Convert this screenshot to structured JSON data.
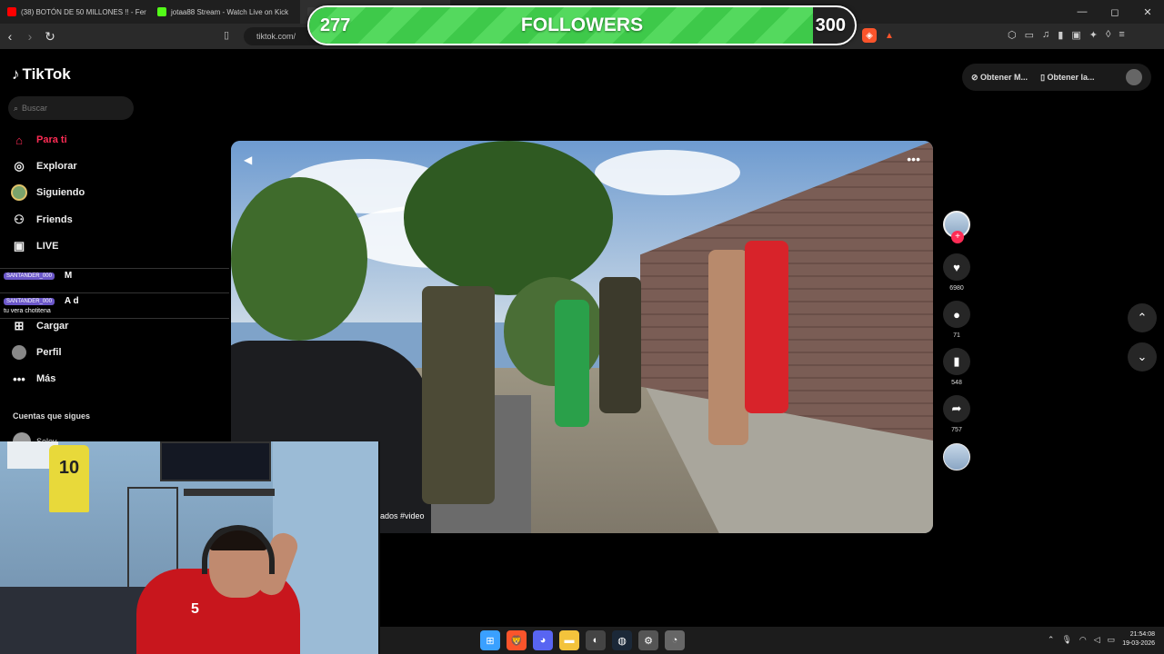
{
  "browser": {
    "tabs": [
      {
        "title": "(38) BOTÓN DE 50 MILLONES !! - Fer",
        "color": "#ff0000"
      },
      {
        "title": "jotaa88 Stream - Watch Live on Kick",
        "color": "#53fc18"
      },
      {
        "title": "",
        "color": "#3a3a3a"
      }
    ],
    "url": "tiktok.com/",
    "window_controls": {
      "minimize": "—",
      "maximize": "◻",
      "close": "✕"
    }
  },
  "overlay": {
    "goal_current": "277",
    "goal_title": "FOLLOWERS",
    "goal_max": "300",
    "progress_fraction": 0.923
  },
  "tiktok": {
    "logo": "TikTok",
    "search_placeholder": "Buscar",
    "sidebar": [
      {
        "label": "Para ti",
        "icon": "home-icon",
        "glyph": "⌂",
        "active": true
      },
      {
        "label": "Explorar",
        "icon": "compass-icon",
        "glyph": "◎",
        "active": false
      },
      {
        "label": "Siguiendo",
        "icon": "following-avatar-icon",
        "glyph": "●",
        "active": false
      },
      {
        "label": "Friends",
        "icon": "friends-icon",
        "glyph": "👥",
        "active": false
      },
      {
        "label": "LIVE",
        "icon": "live-icon",
        "glyph": "▣",
        "active": false
      },
      {
        "label": "Cargar",
        "icon": "upload-icon",
        "glyph": "⊞",
        "active": false
      },
      {
        "label": "Perfil",
        "icon": "profile-icon",
        "glyph": "◉",
        "active": false
      },
      {
        "label": "Más",
        "icon": "more-icon",
        "glyph": "•••",
        "active": false
      }
    ],
    "hidden_items": [
      "M",
      "A  d"
    ],
    "section_title": "Cuentas que sigues",
    "followed_account": "Selev",
    "chat": [
      {
        "badge": "SANTANDER_000",
        "text": ""
      },
      {
        "badge": "SANTANDER_000",
        "text": ""
      },
      {
        "badge": "",
        "text": "tu vera chotitena"
      }
    ],
    "top_actions": [
      "Obtener M...",
      "Obtener la..."
    ],
    "video_caption": "ados #video",
    "counts": {
      "likes": "6980",
      "comments": "71",
      "saves": "548",
      "shares": "757"
    }
  },
  "webcam": {
    "jersey_number": "10",
    "shirt_number": "5"
  },
  "taskbar": {
    "apps": [
      {
        "name": "windows-start-icon",
        "glyph": "⊞",
        "color": "#3aa0ff"
      },
      {
        "name": "brave-browser-icon",
        "glyph": "🦁",
        "color": "#fb542b"
      },
      {
        "name": "discord-icon",
        "glyph": "◕",
        "color": "#5865f2"
      },
      {
        "name": "file-explorer-icon",
        "glyph": "▬",
        "color": "#f3c33c"
      },
      {
        "name": "obs-icon",
        "glyph": "◐",
        "color": "#444"
      },
      {
        "name": "steam-icon",
        "glyph": "◍",
        "color": "#1b2838"
      },
      {
        "name": "settings-icon",
        "glyph": "⚙",
        "color": "#555"
      },
      {
        "name": "app-icon",
        "glyph": "◔",
        "color": "#666"
      }
    ],
    "time": "21:54:08",
    "date": "19-03-2026"
  }
}
